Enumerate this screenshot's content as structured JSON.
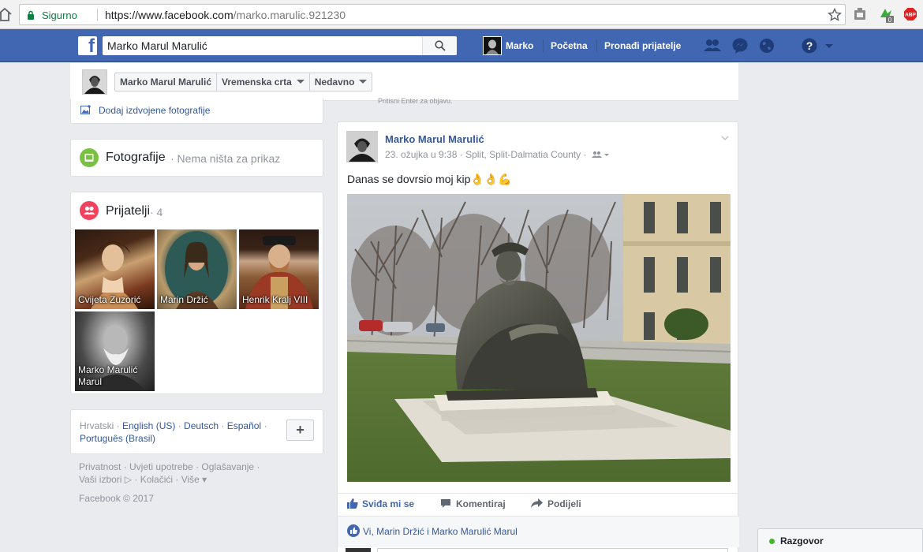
{
  "browser": {
    "secure_label": "Sigurno",
    "url_host": "https://www.facebook.com",
    "url_path": "/marko.marulic.921230",
    "ext_badge": "0",
    "abp_label": "ABP"
  },
  "topbar": {
    "logo": "f",
    "search_value": "Marko Marul Marulić",
    "profile_name": "Marko",
    "home_label": "Početna",
    "find_friends_label": "Pronađi prijatelje"
  },
  "timeline_header": {
    "name_tab": "Marko Marul Marulić",
    "timeline_tab": "Vremenska crta",
    "recent_tab": "Nedavno",
    "hint": "Pritisni Enter za objavu."
  },
  "left": {
    "add_featured": "Dodaj izdvojene fotografije",
    "photos_title": "Fotografije",
    "photos_sub": "· Nema ništa za prikaz",
    "friends_title": "Prijatelji",
    "friends_count": "· 4",
    "friends": [
      {
        "name": "Cvijeta Zuzorić"
      },
      {
        "name": "Marin Držić"
      },
      {
        "name": "Henrik Kralj VIII"
      },
      {
        "name": "Marko Marulić Marul"
      }
    ],
    "lang_current": "Hrvatski · ",
    "lang_en": "English (US)",
    "lang_de": "Deutsch",
    "lang_es": "Español",
    "lang_pt": "Português (Brasil)",
    "lang_add": "+",
    "footer": "Privatnost · Uvjeti upotrebe · Oglašavanje · Vaši izbori ▷ · Kolačići · Više ▾",
    "copyright": "Facebook © 2017"
  },
  "post": {
    "author": "Marko Marul Marulić",
    "meta": "23. ožujka u 9:38 · Split, Split-Dalmatia County ·",
    "text": "Danas se dovrsio moj kip👌👌💪",
    "like_label": "Sviđa mi se",
    "comment_label": "Komentiraj",
    "share_label": "Podijeli",
    "likes_text": "Vi, Marin Držić i Marko Marulić Marul"
  },
  "chat": {
    "label": "Razgovor"
  },
  "colors": {
    "fb_blue": "#4267b2",
    "link": "#365899",
    "secure_green": "#0b8043",
    "online_green": "#42b72a"
  }
}
